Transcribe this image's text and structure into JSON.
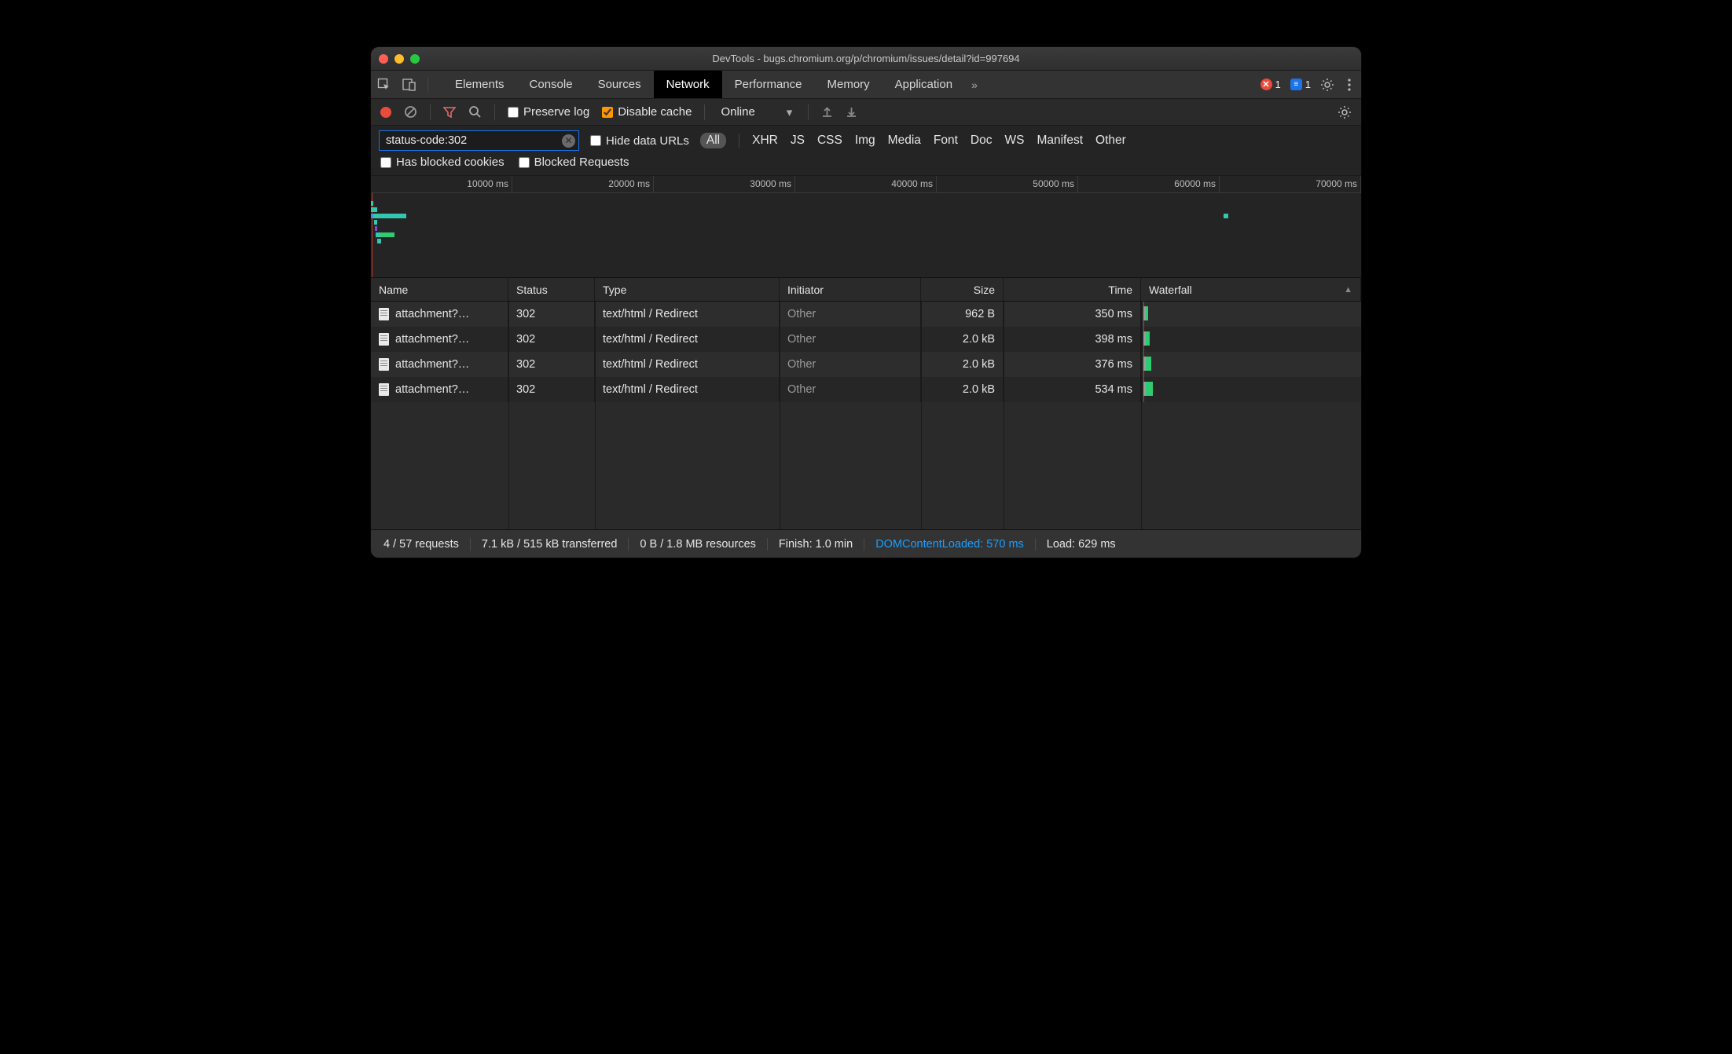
{
  "window": {
    "title": "DevTools - bugs.chromium.org/p/chromium/issues/detail?id=997694"
  },
  "tabs": {
    "items": [
      "Elements",
      "Console",
      "Sources",
      "Network",
      "Performance",
      "Memory",
      "Application"
    ],
    "active": "Network",
    "overflow_icon": "»",
    "errors_count": "1",
    "messages_count": "1"
  },
  "toolbar": {
    "preserve_log_label": "Preserve log",
    "preserve_log_checked": false,
    "disable_cache_label": "Disable cache",
    "disable_cache_checked": true,
    "throttling_value": "Online"
  },
  "filter": {
    "query": "status-code:302",
    "hide_data_urls_label": "Hide data URLs",
    "hide_data_urls_checked": false,
    "types": [
      "All",
      "XHR",
      "JS",
      "CSS",
      "Img",
      "Media",
      "Font",
      "Doc",
      "WS",
      "Manifest",
      "Other"
    ],
    "active_type": "All",
    "has_blocked_cookies_label": "Has blocked cookies",
    "has_blocked_cookies_checked": false,
    "blocked_requests_label": "Blocked Requests",
    "blocked_requests_checked": false
  },
  "overview": {
    "ticks": [
      "10000 ms",
      "20000 ms",
      "30000 ms",
      "40000 ms",
      "50000 ms",
      "60000 ms",
      "70000 ms"
    ]
  },
  "table": {
    "columns": [
      "Name",
      "Status",
      "Type",
      "Initiator",
      "Size",
      "Time",
      "Waterfall"
    ],
    "sort_column": "Waterfall",
    "sort_dir": "asc",
    "rows": [
      {
        "name": "attachment?…",
        "status": "302",
        "type": "text/html / Redirect",
        "initiator": "Other",
        "size": "962 B",
        "time": "350 ms"
      },
      {
        "name": "attachment?…",
        "status": "302",
        "type": "text/html / Redirect",
        "initiator": "Other",
        "size": "2.0 kB",
        "time": "398 ms"
      },
      {
        "name": "attachment?…",
        "status": "302",
        "type": "text/html / Redirect",
        "initiator": "Other",
        "size": "2.0 kB",
        "time": "376 ms"
      },
      {
        "name": "attachment?…",
        "status": "302",
        "type": "text/html / Redirect",
        "initiator": "Other",
        "size": "2.0 kB",
        "time": "534 ms"
      }
    ]
  },
  "status": {
    "requests": "4 / 57 requests",
    "transferred": "7.1 kB / 515 kB transferred",
    "resources": "0 B / 1.8 MB resources",
    "finish": "Finish: 1.0 min",
    "domcontentloaded": "DOMContentLoaded: 570 ms",
    "load": "Load: 629 ms"
  }
}
